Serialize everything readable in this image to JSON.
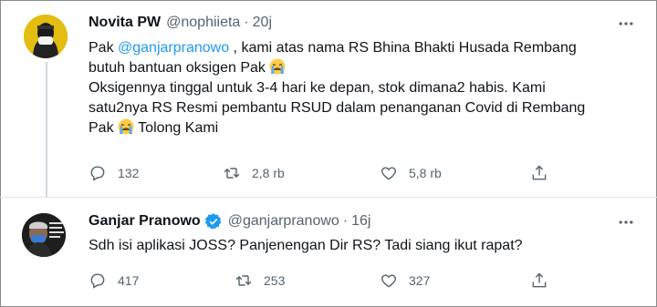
{
  "tweet1": {
    "author_name": "Novita PW",
    "handle": "@nophiieta",
    "separator": "·",
    "time": "20j",
    "line1_pre": "Pak ",
    "mention": "@ganjarpranowo",
    "line1_post": " , kami atas nama RS Bhina Bhakti Husada Rembang",
    "line2": "butuh bantuan oksigen Pak ",
    "line3": "Oksigennya tinggal untuk 3-4 hari ke depan, stok dimana2 habis. Kami",
    "line4": "satu2nya RS Resmi pembantu RSUD dalam penanganan Covid di Rembang",
    "line5_pre": "Pak ",
    "line5_post": " Tolong Kami",
    "stats": {
      "replies": "132",
      "retweets": "2,8 rb",
      "likes": "5,8 rb"
    }
  },
  "tweet2": {
    "author_name": "Ganjar Pranowo",
    "handle": "@ganjarpranowo",
    "separator": "·",
    "time": "16j",
    "text": "Sdh isi aplikasi JOSS? Panjenengan Dir RS? Tadi siang ikut rapat?",
    "stats": {
      "replies": "417",
      "retweets": "253",
      "likes": "327"
    }
  },
  "icons": {
    "reply": "reply-icon",
    "retweet": "retweet-icon",
    "like": "like-icon",
    "share": "share-icon",
    "more": "more-icon",
    "verified": "verified-badge-icon",
    "emoji": "crying-face-emoji"
  },
  "colors": {
    "link": "#1d9bf0",
    "secondary_text": "#536471",
    "verified": "#1d9bf0"
  }
}
